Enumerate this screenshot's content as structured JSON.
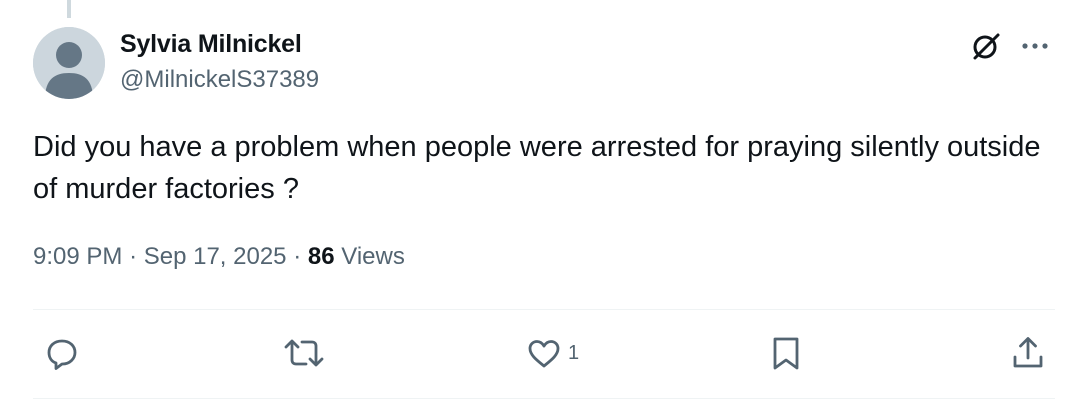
{
  "author": {
    "display_name": "Sylvia Milnickel",
    "handle": "@MilnickelS37389",
    "avatar_icon": "default-profile-avatar"
  },
  "tweet": {
    "text": "Did you have a problem when people were arrested for praying silently outside of murder factories ?",
    "time": "9:09 PM",
    "separator": "·",
    "date": "Sep 17, 2025",
    "views_count": "86",
    "views_label": "Views"
  },
  "actions": {
    "reply_icon": "reply-icon",
    "retweet_icon": "retweet-icon",
    "like_icon": "like-icon",
    "like_count": "1",
    "bookmark_icon": "bookmark-icon",
    "share_icon": "share-icon"
  },
  "header_icons": {
    "grok": "grok-icon",
    "more": "more-options-icon"
  },
  "colors": {
    "text_primary": "#0f1419",
    "text_secondary": "#536471",
    "divider": "#eff3f4",
    "avatar_bg": "#ccd6dd"
  }
}
